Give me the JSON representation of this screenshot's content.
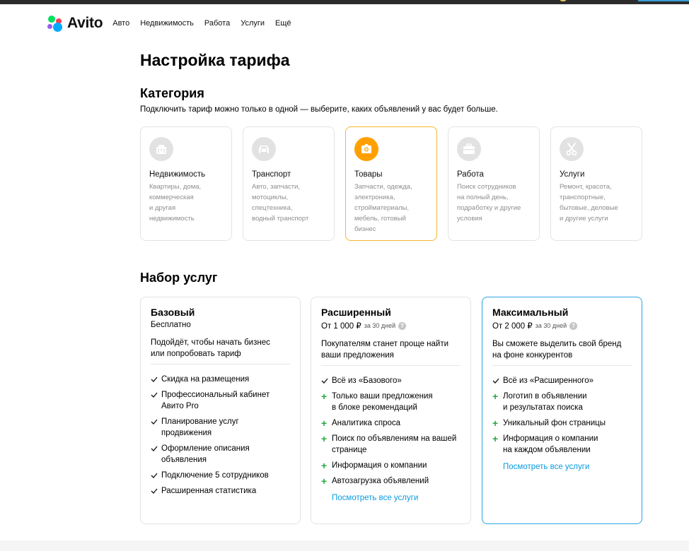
{
  "brand": {
    "name": "Avito"
  },
  "nav": [
    "Авто",
    "Недвижимость",
    "Работа",
    "Услуги",
    "Ещё"
  ],
  "page": {
    "title": "Настройка тарифа"
  },
  "category": {
    "title": "Категория",
    "subtitle": "Подключить тариф можно только в одной — выберите, каких объявлений у вас будет больше.",
    "items": [
      {
        "name": "Недвижимость",
        "icon": "building-icon",
        "desc": [
          "Квартиры, дома,",
          "коммерческая",
          "и другая",
          "недвижимость"
        ],
        "selected": false
      },
      {
        "name": "Транспорт",
        "icon": "car-icon",
        "desc": [
          "Авто, запчасти,",
          "мотоциклы,",
          "спецтехника,",
          "водный транспорт"
        ],
        "selected": false
      },
      {
        "name": "Товары",
        "icon": "camera-icon",
        "desc": [
          "Запчасти, одежда,",
          "электроника,",
          "стройматериалы,",
          "мебель, готовый",
          "бизнес"
        ],
        "selected": true
      },
      {
        "name": "Работа",
        "icon": "briefcase-icon",
        "desc": [
          "Поиск сотрудников",
          "на полный день,",
          "подработку и другие",
          "условия"
        ],
        "selected": false
      },
      {
        "name": "Услуги",
        "icon": "scissors-icon",
        "desc": [
          "Ремонт, красота,",
          "транспортные,",
          "бытовые, деловые",
          "и другие услуги"
        ],
        "selected": false
      }
    ]
  },
  "services": {
    "title": "Набор услуг",
    "plans": [
      {
        "name": "Базовый",
        "price": "Бесплатно",
        "period": "",
        "desc": [
          "Подойдёт, чтобы начать бизнес",
          "или попробовать тариф"
        ],
        "features": [
          {
            "kind": "check",
            "lines": [
              "Скидка на размещения"
            ]
          },
          {
            "kind": "check",
            "lines": [
              "Профессиональный кабинет",
              "Авито Pro"
            ]
          },
          {
            "kind": "check",
            "lines": [
              "Планирование услуг",
              "продвижения"
            ]
          },
          {
            "kind": "check",
            "lines": [
              "Оформление описания",
              "объявления"
            ]
          },
          {
            "kind": "check",
            "lines": [
              "Подключение 5 сотрудников"
            ]
          },
          {
            "kind": "check",
            "lines": [
              "Расширенная статистика"
            ]
          }
        ],
        "more": "",
        "selected": false
      },
      {
        "name": "Расширенный",
        "price": "От 1 000 ₽",
        "period": "за 30 дней",
        "desc": [
          "Покупателям станет проще найти",
          "ваши предложения"
        ],
        "features": [
          {
            "kind": "check",
            "lines": [
              "Всё из «Базового»"
            ]
          },
          {
            "kind": "plus",
            "lines": [
              "Только ваши предложения",
              "в блоке рекомендаций"
            ]
          },
          {
            "kind": "plus",
            "lines": [
              "Аналитика спроса"
            ]
          },
          {
            "kind": "plus",
            "lines": [
              "Поиск по объявлениям на вашей",
              "странице"
            ]
          },
          {
            "kind": "plus",
            "lines": [
              "Информация о компании"
            ]
          },
          {
            "kind": "plus",
            "lines": [
              "Автозагрузка объявлений"
            ]
          }
        ],
        "more": "Посмотреть все услуги",
        "selected": false
      },
      {
        "name": "Максимальный",
        "price": "От 2 000 ₽",
        "period": "за 30 дней",
        "desc": [
          "Вы сможете выделить свой бренд",
          "на фоне конкурентов"
        ],
        "features": [
          {
            "kind": "check",
            "lines": [
              "Всё из «Расширенного»"
            ]
          },
          {
            "kind": "plus",
            "lines": [
              "Логотип в объявлении",
              "и результатах поиска"
            ]
          },
          {
            "kind": "plus",
            "lines": [
              "Уникальный фон страницы"
            ]
          },
          {
            "kind": "plus",
            "lines": [
              "Информация о компании",
              "на каждом объявлении"
            ]
          }
        ],
        "more": "Посмотреть все услуги",
        "selected": true
      }
    ]
  },
  "colors": {
    "accent_orange": "#ffa000",
    "selected_border_orange": "#f5b72e",
    "selected_border_blue": "#2aa5e4",
    "link": "#0a9be0",
    "plus_green": "#28a745"
  }
}
